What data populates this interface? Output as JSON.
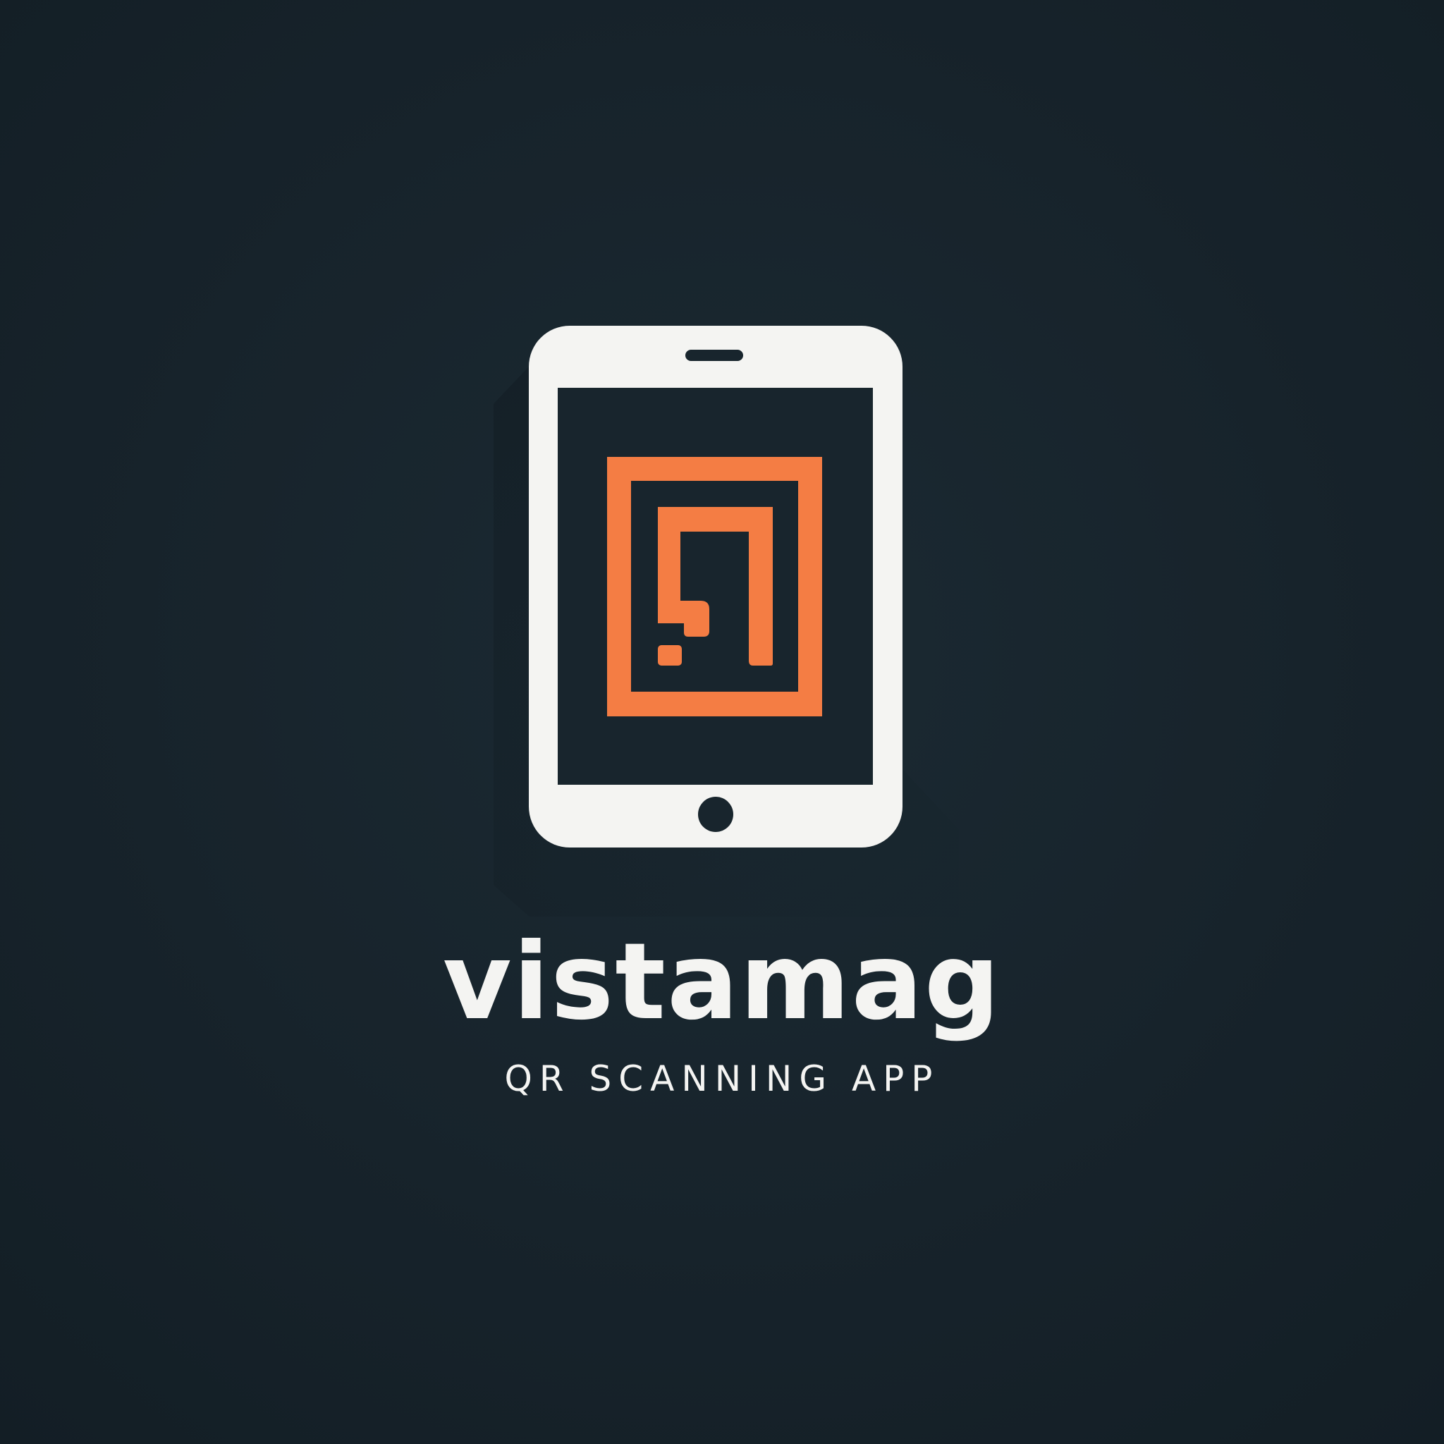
{
  "brand": {
    "name": "vistamag",
    "tagline": "QR SCANNING APP"
  },
  "colors": {
    "background": "#17232b",
    "device": "#f4f4f2",
    "screen": "#18252d",
    "accent": "#f47d44",
    "text": "#f4f4f2"
  },
  "icon": {
    "device": "tablet-icon",
    "symbol": "qr-code-icon"
  }
}
